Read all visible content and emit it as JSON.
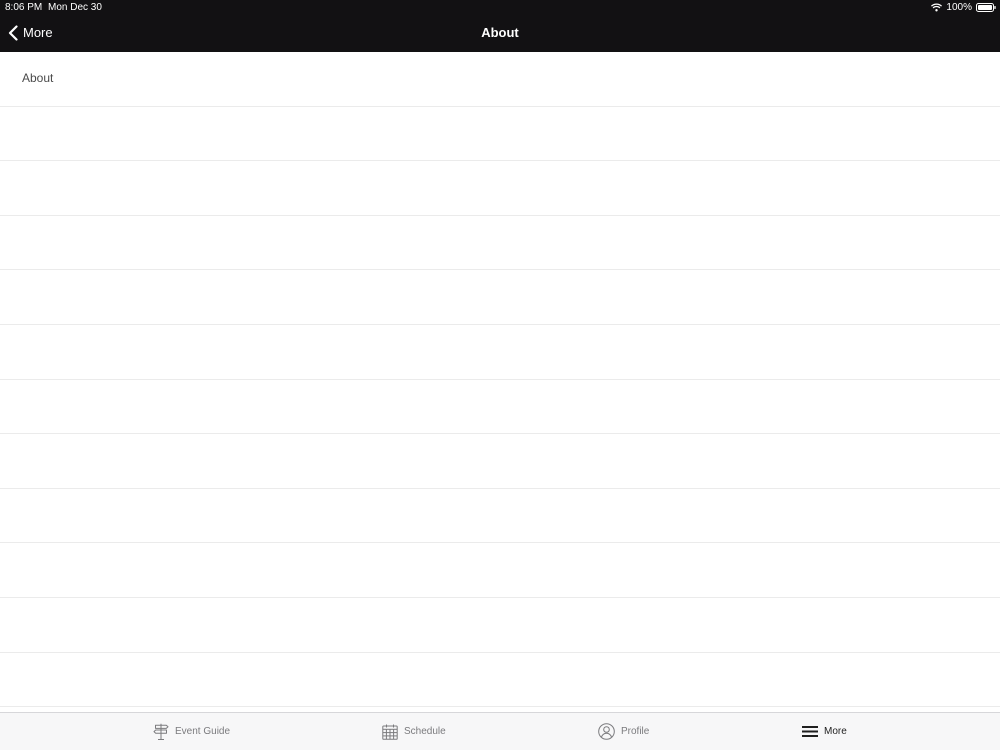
{
  "status_bar": {
    "time": "8:06 PM",
    "date": "Mon Dec 30",
    "battery": "100%",
    "wifi_icon": "wifi-icon",
    "battery_icon": "battery-icon"
  },
  "nav": {
    "back_label": "More",
    "back_icon": "chevron-left-icon",
    "title": "About"
  },
  "list": {
    "rows": [
      {
        "label": "About"
      },
      {
        "label": ""
      },
      {
        "label": ""
      },
      {
        "label": ""
      },
      {
        "label": ""
      },
      {
        "label": ""
      },
      {
        "label": ""
      },
      {
        "label": ""
      },
      {
        "label": ""
      },
      {
        "label": ""
      },
      {
        "label": ""
      },
      {
        "label": ""
      }
    ]
  },
  "tab_bar": {
    "tabs": [
      {
        "label": "Event Guide",
        "icon": "signpost-icon",
        "active": false
      },
      {
        "label": "Schedule",
        "icon": "calendar-icon",
        "active": false
      },
      {
        "label": "Profile",
        "icon": "user-circle-icon",
        "active": false
      },
      {
        "label": "More",
        "icon": "menu-icon",
        "active": true
      }
    ]
  },
  "colors": {
    "header_bg": "#121113",
    "header_text": "#ffffff",
    "row_divider": "#ebebeb",
    "row_text": "#4a4a4a",
    "tab_bar_bg": "#f7f7f8",
    "tab_inactive": "#7b7b7e",
    "tab_active": "#1f1f1f"
  }
}
